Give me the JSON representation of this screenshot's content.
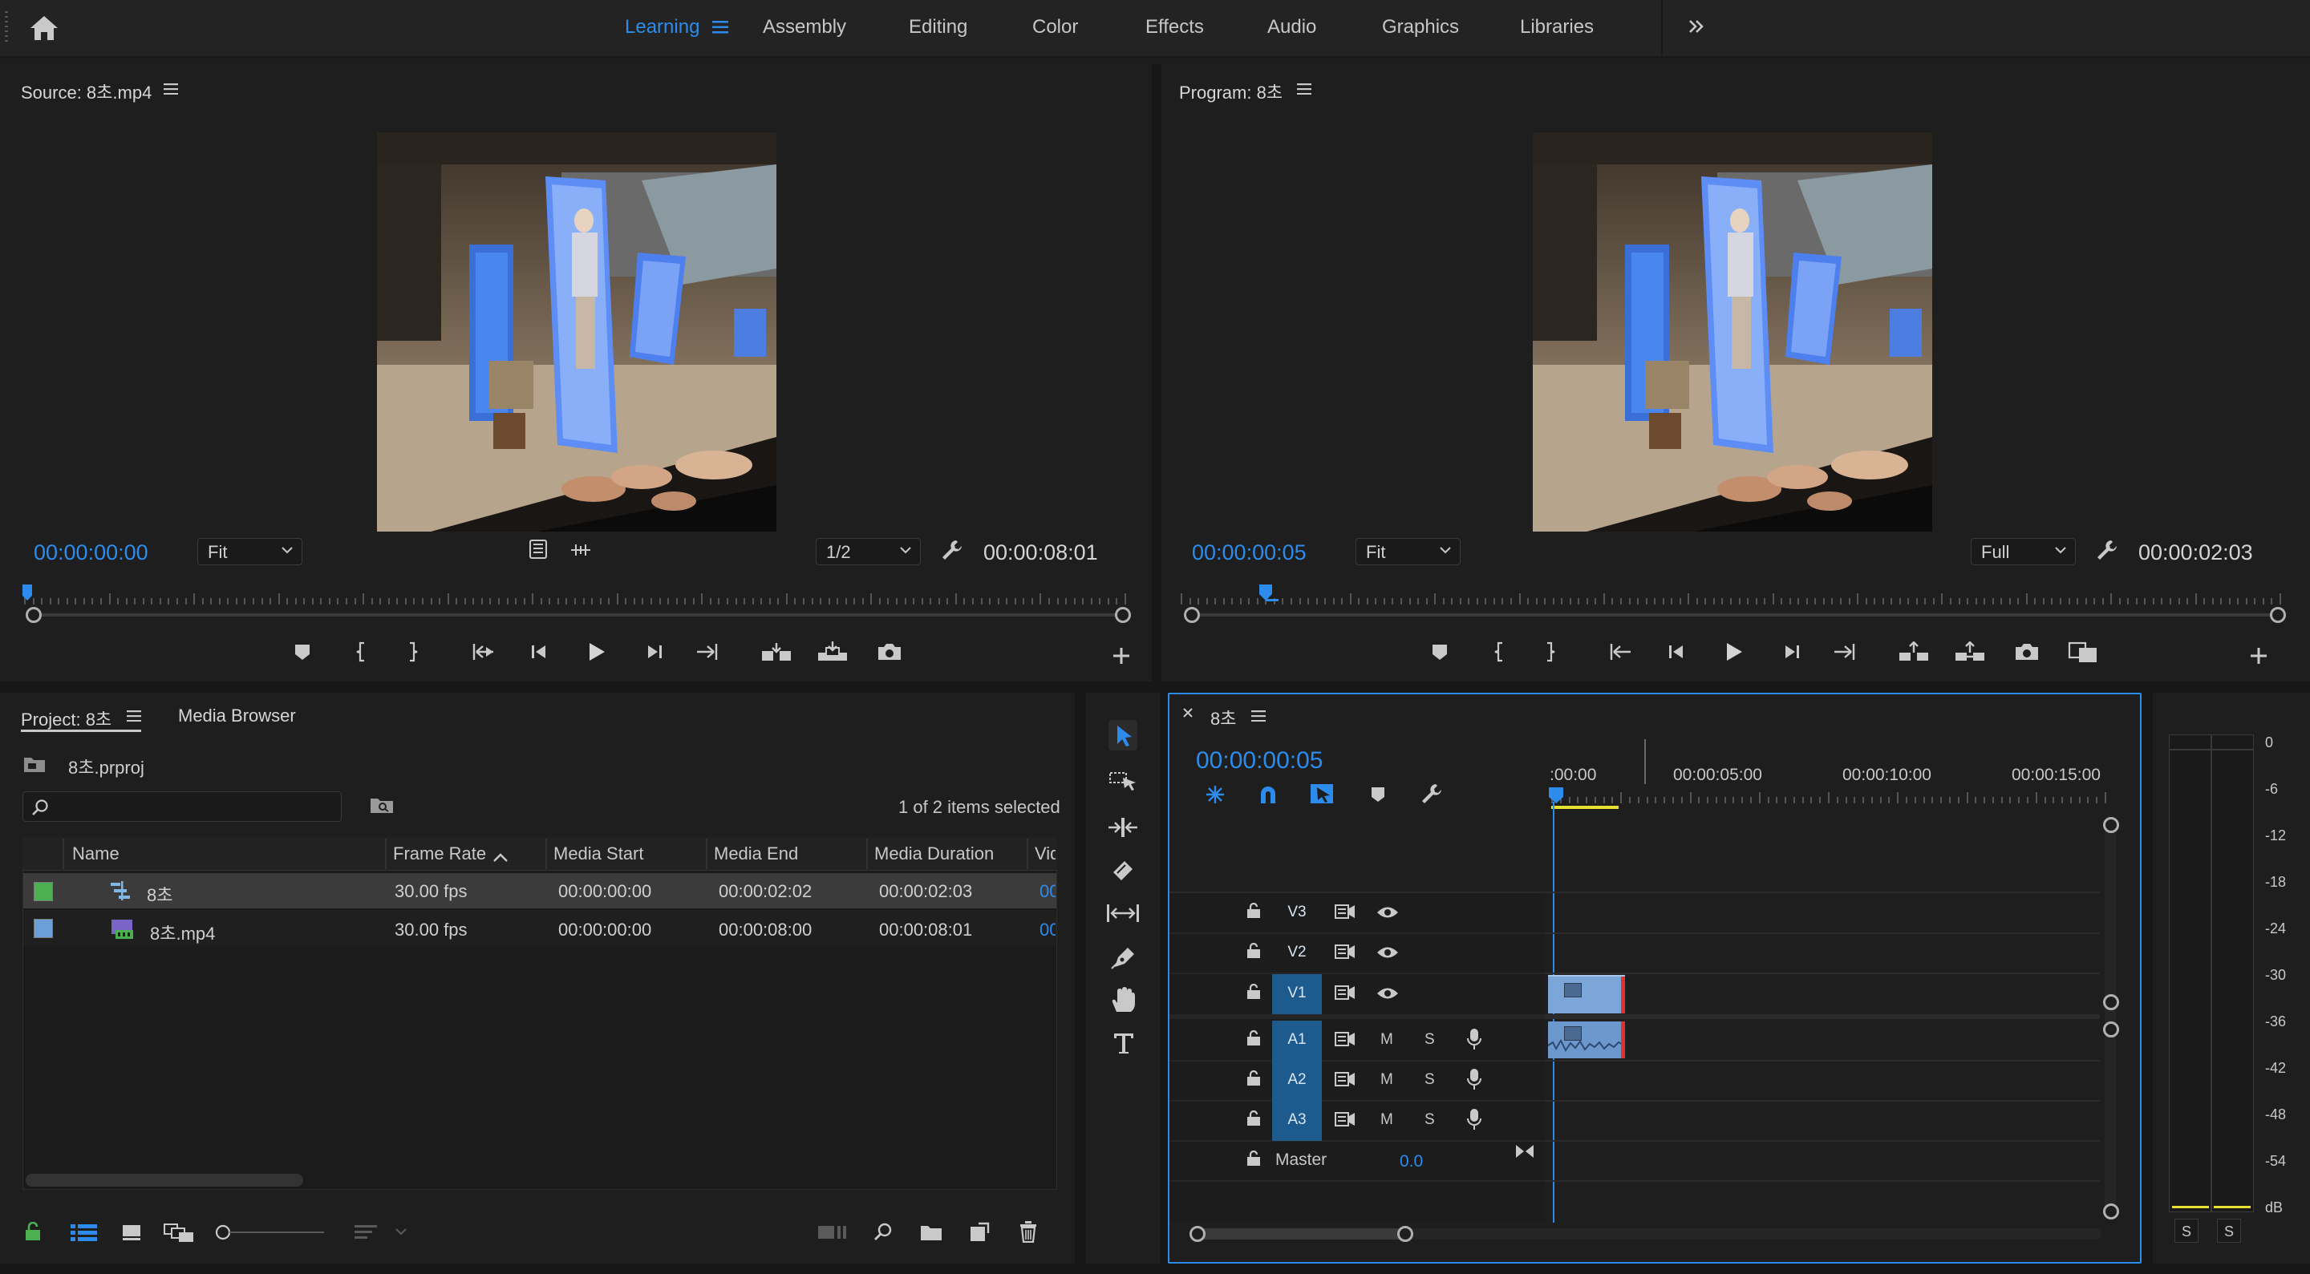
{
  "workspaces": {
    "home_icon": "home-icon",
    "tabs": [
      "Learning",
      "Assembly",
      "Editing",
      "Color",
      "Effects",
      "Audio",
      "Graphics",
      "Libraries"
    ],
    "active": "Learning",
    "more_icon": "chevrons-right-icon"
  },
  "source": {
    "title": "Source: 8초.mp4",
    "timecode": "00:00:00:00",
    "zoom": "Fit",
    "resolution": "1/2",
    "duration": "00:00:08:01",
    "playhead_fraction": 0.0
  },
  "program": {
    "title": "Program: 8초",
    "timecode": "00:00:00:05",
    "zoom": "Fit",
    "resolution": "Full",
    "duration": "00:00:02:03",
    "playhead_fraction": 0.06
  },
  "project": {
    "tabs": [
      "Project: 8초",
      "Media Browser"
    ],
    "file": "8초.prproj",
    "search_placeholder": "",
    "selection_status": "1 of 2 items selected",
    "columns": [
      "Name",
      "Frame Rate",
      "Media Start",
      "Media End",
      "Media Duration",
      "Vid"
    ],
    "rows": [
      {
        "color": "#4caf50",
        "name": "8초",
        "frame_rate": "30.00 fps",
        "media_start": "00:00:00:00",
        "media_end": "00:00:02:02",
        "media_duration": "00:00:02:03",
        "vid": "00",
        "selected": true,
        "icon": "sequence-icon"
      },
      {
        "color": "#6a9fd8",
        "name": "8초.mp4",
        "frame_rate": "30.00 fps",
        "media_start": "00:00:00:00",
        "media_end": "00:00:08:00",
        "media_duration": "00:00:08:01",
        "vid": "00",
        "selected": false,
        "icon": "video-clip-icon"
      }
    ]
  },
  "timeline": {
    "tab": "8초",
    "timecode": "00:00:00:05",
    "ruler_labels": [
      ":00:00",
      "00:00:05:00",
      "00:00:10:00",
      "00:00:15:00"
    ],
    "video_tracks": [
      "V3",
      "V2",
      "V1"
    ],
    "audio_tracks": [
      "A1",
      "A2",
      "A3"
    ],
    "mute_label": "M",
    "solo_label": "S",
    "master_label": "Master",
    "master_value": "0.0"
  },
  "meter": {
    "scale": [
      "0",
      "-6",
      "-12",
      "-18",
      "-24",
      "-30",
      "-36",
      "-42",
      "-48",
      "-54",
      "dB"
    ],
    "solo_labels": [
      "S",
      "S"
    ]
  },
  "colors": {
    "accent": "#2d8ceb",
    "panel_bg": "#1e1e1e",
    "track_on": "#1d5b8e",
    "clip_blue": "#7ca6d8"
  }
}
